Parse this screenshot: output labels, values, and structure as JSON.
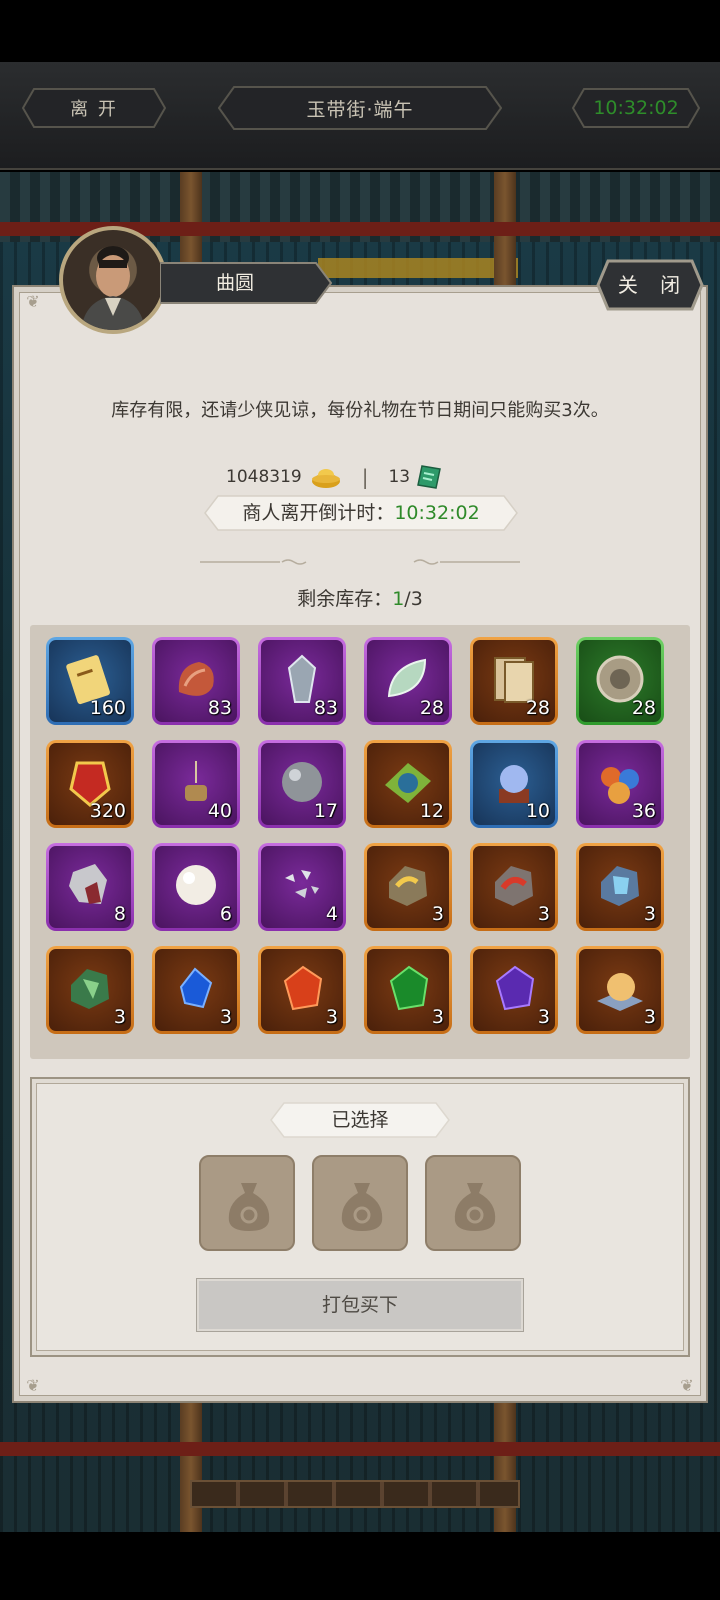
{
  "topbar": {
    "leave_label": "离 开",
    "location_title": "玉带街·端午",
    "clock": "10:32:02"
  },
  "merchant": {
    "name": "曲圆",
    "close_label": "关 闭"
  },
  "notice": "库存有限，还请少侠见谅，每份礼物在节日期间只能购买3次。",
  "wallet": {
    "gold": "1048319",
    "separator": "|",
    "tickets": "13",
    "gold_icon": "gold-ingot-icon",
    "ticket_icon": "green-ticket-icon"
  },
  "countdown": {
    "label": "商人离开倒计时：",
    "time": "10:32:02"
  },
  "stock": {
    "label": "剩余库存：",
    "current": "1",
    "total": "/3"
  },
  "items": [
    {
      "qty": "160",
      "quality": "blue",
      "icon": "scroll-card-icon"
    },
    {
      "qty": "83",
      "quality": "purple",
      "icon": "meat-icon"
    },
    {
      "qty": "83",
      "quality": "purple",
      "icon": "crystal-icon"
    },
    {
      "qty": "28",
      "quality": "purple",
      "icon": "jade-leaf-icon"
    },
    {
      "qty": "28",
      "quality": "orange",
      "icon": "book-icon"
    },
    {
      "qty": "28",
      "quality": "green",
      "icon": "bronze-disc-icon"
    },
    {
      "qty": "320",
      "quality": "orange",
      "icon": "red-token-icon"
    },
    {
      "qty": "40",
      "quality": "purple",
      "icon": "incense-burner-icon"
    },
    {
      "qty": "17",
      "quality": "purple",
      "icon": "iron-ball-icon"
    },
    {
      "qty": "12",
      "quality": "orange",
      "icon": "green-rune-icon"
    },
    {
      "qty": "10",
      "quality": "blue",
      "icon": "crystal-orb-icon"
    },
    {
      "qty": "36",
      "quality": "purple",
      "icon": "pearls-icon"
    },
    {
      "qty": "8",
      "quality": "purple",
      "icon": "red-ore-icon"
    },
    {
      "qty": "6",
      "quality": "purple",
      "icon": "pearl-icon"
    },
    {
      "qty": "4",
      "quality": "purple",
      "icon": "silver-shards-icon"
    },
    {
      "qty": "3",
      "quality": "orange",
      "icon": "gold-ore-icon"
    },
    {
      "qty": "3",
      "quality": "orange",
      "icon": "red-ore-2-icon"
    },
    {
      "qty": "3",
      "quality": "orange",
      "icon": "blue-ore-icon"
    },
    {
      "qty": "3",
      "quality": "orange",
      "icon": "green-ore-icon"
    },
    {
      "qty": "3",
      "quality": "orange",
      "icon": "blue-gem-icon"
    },
    {
      "qty": "3",
      "quality": "orange",
      "icon": "fire-gem-icon"
    },
    {
      "qty": "3",
      "quality": "orange",
      "icon": "green-gem-icon"
    },
    {
      "qty": "3",
      "quality": "orange",
      "icon": "purple-gem-icon"
    },
    {
      "qty": "3",
      "quality": "orange",
      "icon": "amber-orb-icon"
    }
  ],
  "selection": {
    "title": "已选择",
    "buy_label": "打包买下"
  },
  "colors": {
    "accent_green": "#2f8a2a",
    "panel_bg": "#e6e1db"
  }
}
